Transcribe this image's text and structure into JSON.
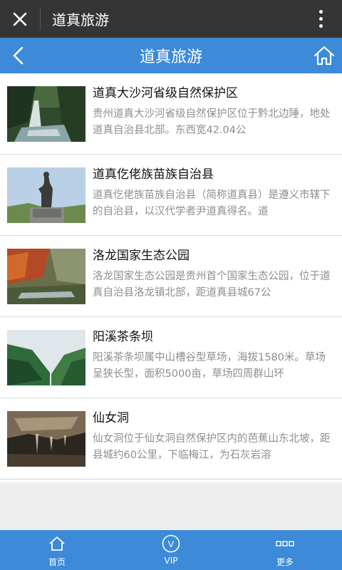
{
  "app_bar": {
    "title": "道真旅游"
  },
  "header": {
    "title": "道真旅游"
  },
  "items": [
    {
      "title": "道真大沙河省级自然保护区",
      "desc": "贵州道真大沙河省级自然保护区位于黔北边陲，地处道真自治县北部。东西宽42.04公"
    },
    {
      "title": "道真仡佬族苗族自治县",
      "desc": "道真仡佬族苗族自治县（简称道真县）是遵义市辖下的自治县，以汉代学者尹道真得名。道"
    },
    {
      "title": "洛龙国家生态公园",
      "desc": "洛龙国家生态公园是贵州首个国家生态公园，位于道真自治县洛龙镇北部，距道真县城67公"
    },
    {
      "title": "阳溪茶条坝",
      "desc": "阳溪茶条坝属中山槽谷型草场，海拔1580米。草场呈狭长型，面积5000亩，草场四周群山环"
    },
    {
      "title": "仙女洞",
      "desc": "仙女洞位于仙女洞自然保护区内的芭蕉山东北坡，距县城约60公里，下临梅江，为石灰岩溶"
    }
  ],
  "tabbar": {
    "home": "首页",
    "vip": "VIP",
    "vip_icon_text": "V",
    "more": "更多"
  },
  "colors": {
    "accent": "#3c8ad8",
    "topbar": "#353535"
  }
}
